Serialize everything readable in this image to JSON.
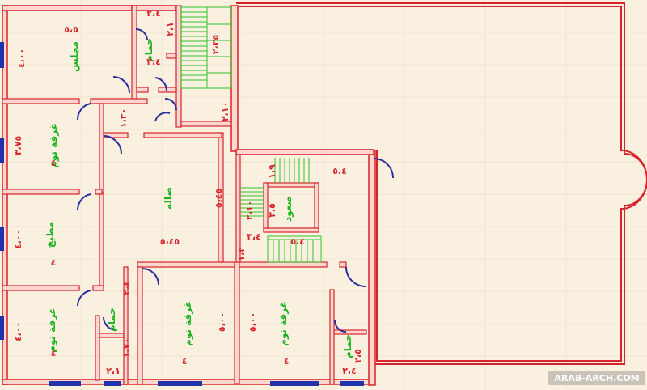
{
  "rooms": {
    "majlis": "مجلس",
    "hamam_top": "حمام",
    "bedroom_left": "غرفة نوم",
    "kitchen": "مطبخ",
    "bedroom_bottom_left": "غرفة نوم",
    "hamam_bottom_left": "حمام",
    "bedroom_center": "غرفة نوم",
    "bedroom_right": "غرفة نوم",
    "hamam_bottom_right": "حمام",
    "hall": "صالة",
    "stair_hall": "صعود"
  },
  "dimensions": {
    "majlis_width": "٥،٥",
    "majlis_height": "٤،٠٠",
    "majlis_side": "٣،٢٥",
    "hamam_top_w": "٢،١",
    "hamam_top_h": "٢،٤",
    "hamam_top_h2": "٢،٤",
    "stair_w": "٢،٣٥",
    "stair_h": "٢،١٠",
    "corr_w": "١،٣٠",
    "bed_left_h": "٣،٧٥",
    "bed_left_w": "٤",
    "hall_h": "٥،٤٥",
    "hall_w": "٥،٤٥",
    "kitchen_h": "٤،٠٠",
    "kitchen_w": "٤",
    "bed_bl_h": "٤،٠٠",
    "bed_bl_w": "٤",
    "hamam_bl_w": "٢،٤",
    "hamam_bl_h": "١،٧٠",
    "hamam_bl_b": "٢،١",
    "bed_c_h": "٥،٠٠",
    "bed_c_w": "٤",
    "bed_r_h": "٥،٠٠",
    "bed_r_w": "٤",
    "hamam_br_w": "٢،٥",
    "hamam_br_b": "٢،٤",
    "stair2_top": "٥،٤",
    "stair2_left": "١،٩",
    "stair2_side": "٢،١٠",
    "stair2_mid": "٣،٥",
    "stair2_bot": "٣،٤",
    "stair2_bot2": "٥،٤",
    "stair2_left2": "١،٢"
  },
  "watermark": "ARAB-ARCH.COM",
  "colors": {
    "background": "#f9f0df",
    "wall": "#d8232a",
    "wall_fill": "#fbd7cf",
    "dimension": "#d8232a",
    "room_label": "#17b21a",
    "stairs": "#2fc22a",
    "door": "#2a2f9c",
    "window": "#2233aa"
  }
}
